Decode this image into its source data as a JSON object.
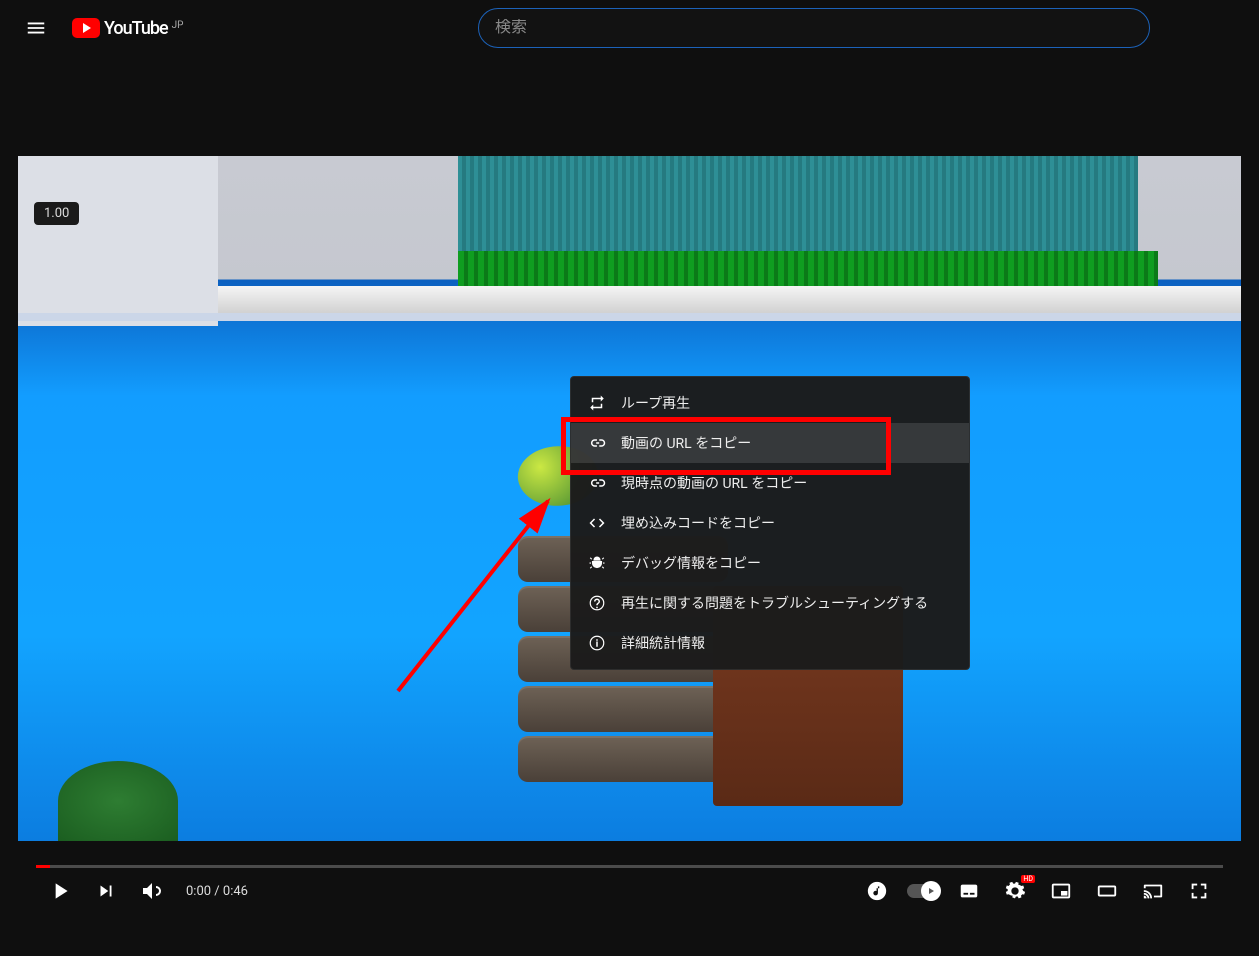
{
  "header": {
    "brand": "YouTube",
    "region": "JP",
    "search_placeholder": "検索"
  },
  "player": {
    "speed_badge": "1.00",
    "time_current": "0:00",
    "time_duration": "0:46"
  },
  "context_menu": {
    "items": [
      {
        "icon": "loop",
        "label": "ループ再生"
      },
      {
        "icon": "link",
        "label": "動画の URL をコピー",
        "hovered": true,
        "highlighted": true
      },
      {
        "icon": "link",
        "label": "現時点の動画の URL をコピー"
      },
      {
        "icon": "embed",
        "label": "埋め込みコードをコピー"
      },
      {
        "icon": "bug",
        "label": "デバッグ情報をコピー"
      },
      {
        "icon": "help",
        "label": "再生に関する問題をトラブルシューティングする"
      },
      {
        "icon": "info",
        "label": "詳細統計情報"
      }
    ]
  }
}
